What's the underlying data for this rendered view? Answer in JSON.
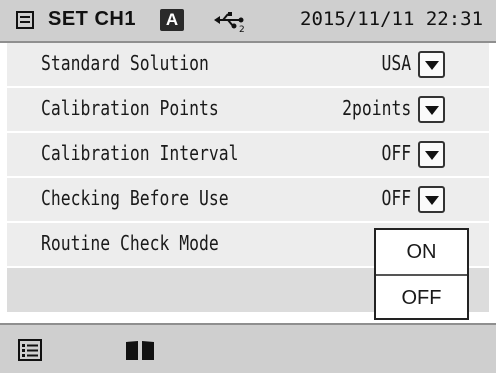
{
  "status": {
    "title": "SET CH1",
    "mode_badge": "A",
    "datetime": "2015/11/11 22:31"
  },
  "rows": [
    {
      "label": "Standard Solution",
      "value": "USA"
    },
    {
      "label": "Calibration Points",
      "value": "2points"
    },
    {
      "label": "Calibration Interval",
      "value": "OFF"
    },
    {
      "label": "Checking Before Use",
      "value": "OFF"
    },
    {
      "label": "Routine Check Mode",
      "value": ""
    }
  ],
  "popup": {
    "options": [
      "ON",
      "OFF"
    ]
  },
  "icons": {
    "sd_card": "sd-card-icon",
    "usb": "usb-icon",
    "list": "list-icon",
    "book": "book-icon"
  },
  "colors": {
    "bar": "#cfcfcf",
    "row": "#ededed",
    "badge": "#2a2a2a"
  }
}
